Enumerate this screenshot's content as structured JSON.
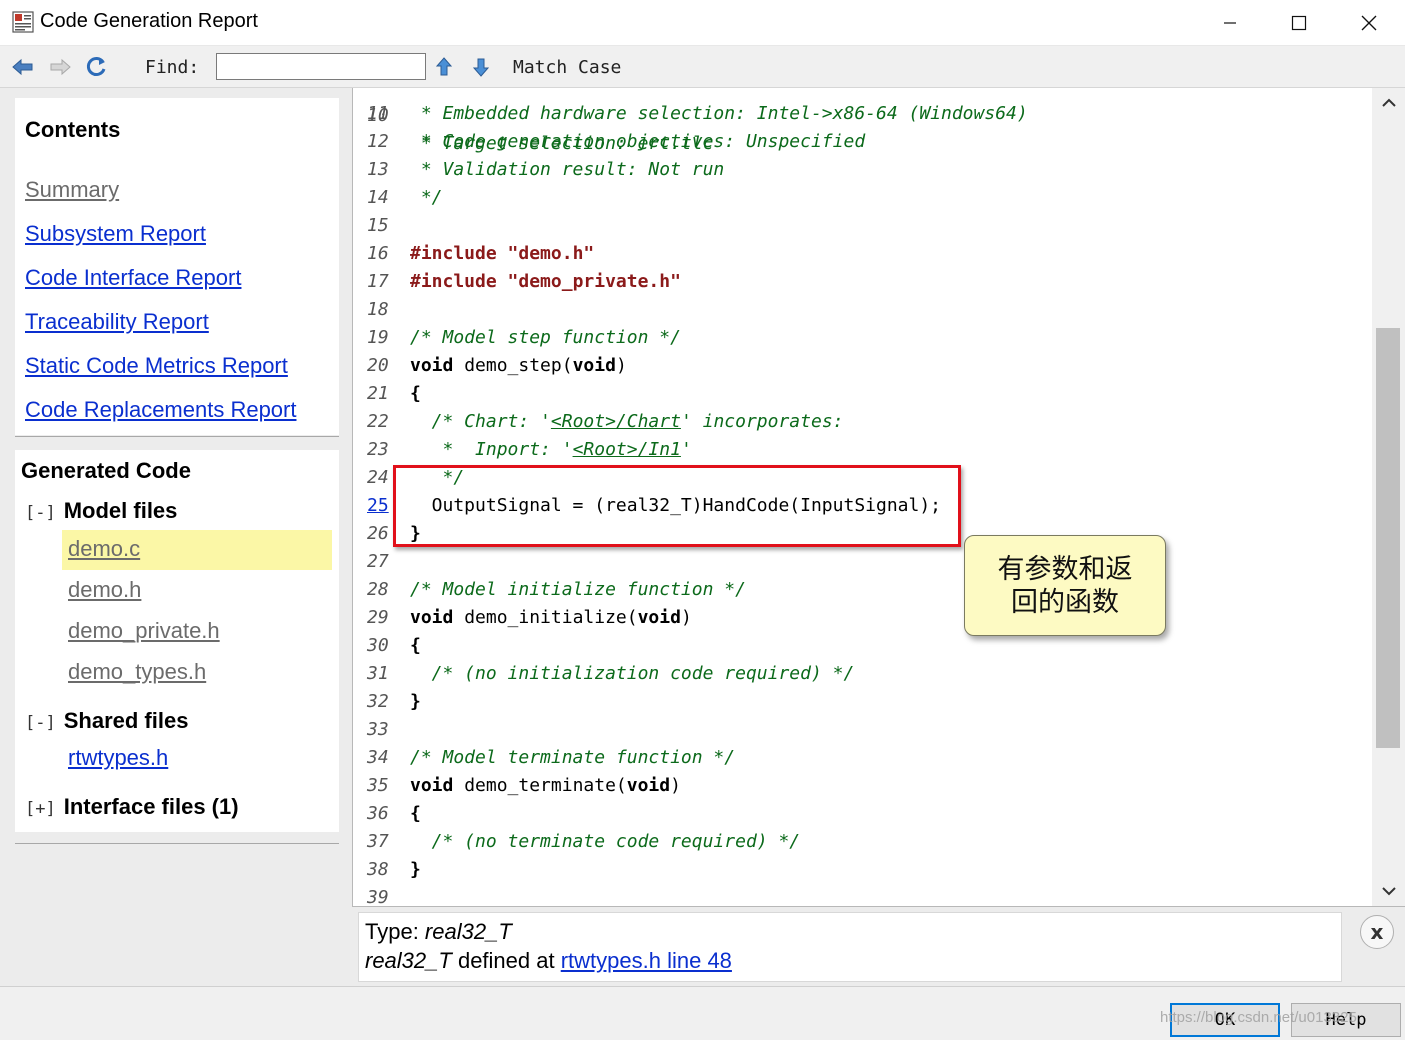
{
  "window": {
    "title": "Code Generation Report"
  },
  "toolbar": {
    "find_label": "Find:",
    "find_value": "",
    "match_case_label": "Match Case"
  },
  "contents": {
    "title": "Contents",
    "links": [
      {
        "label": "Summary",
        "visited": true
      },
      {
        "label": "Subsystem Report",
        "visited": false
      },
      {
        "label": "Code Interface Report",
        "visited": false
      },
      {
        "label": "Traceability Report",
        "visited": false
      },
      {
        "label": "Static Code Metrics Report",
        "visited": false
      },
      {
        "label": "Code Replacements Report",
        "visited": false
      }
    ]
  },
  "generated_code": {
    "title": "Generated Code",
    "model_files": {
      "toggle": "[-]",
      "label": "Model files",
      "files": [
        "demo.c",
        "demo.h",
        "demo_private.h",
        "demo_types.h"
      ],
      "selected": "demo.c"
    },
    "shared_files": {
      "toggle": "[-]",
      "label": "Shared files",
      "files": [
        "rtwtypes.h"
      ]
    },
    "interface_files": {
      "toggle": "[+]",
      "label": "Interface files (1)"
    }
  },
  "code": {
    "top_partial": {
      "num": "10",
      "text": " * Target selection: ert.tlc"
    },
    "lines": [
      {
        "num": "11",
        "text": " * Embedded hardware selection: Intel->x86-64 (Windows64)"
      },
      {
        "num": "12",
        "text": " * Code generation objectives: Unspecified"
      },
      {
        "num": "13",
        "text": " * Validation result: Not run"
      },
      {
        "num": "14",
        "text": " */"
      },
      {
        "num": "15",
        "text": ""
      },
      {
        "num": "16",
        "directive": "#include",
        "string": "\"demo.h\""
      },
      {
        "num": "17",
        "directive": "#include",
        "string": "\"demo_private.h\""
      },
      {
        "num": "18",
        "text": ""
      },
      {
        "num": "19",
        "comment": "/* Model step function */"
      },
      {
        "num": "20",
        "kw1": "void",
        "mid": " demo_step(",
        "kw2": "void",
        "tail": ")"
      },
      {
        "num": "21",
        "brace": "{"
      },
      {
        "num": "22",
        "pre": "  /* Chart: '",
        "link": "<Root>/Chart",
        "post": "' incorporates:"
      },
      {
        "num": "23",
        "pre": "   *  Inport: '",
        "link": "<Root>/In1",
        "post": "'"
      },
      {
        "num": "24",
        "comment": "   */"
      },
      {
        "num": "25",
        "plain": "  OutputSignal = (real32_T)HandCode(InputSignal);",
        "linked": true
      },
      {
        "num": "26",
        "brace": "}"
      },
      {
        "num": "27",
        "text": ""
      },
      {
        "num": "28",
        "comment": "/* Model initialize function */"
      },
      {
        "num": "29",
        "kw1": "void",
        "mid": " demo_initialize(",
        "kw2": "void",
        "tail": ")"
      },
      {
        "num": "30",
        "brace": "{"
      },
      {
        "num": "31",
        "comment": "  /* (no initialization code required) */"
      },
      {
        "num": "32",
        "brace": "}"
      },
      {
        "num": "33",
        "text": ""
      },
      {
        "num": "34",
        "comment": "/* Model terminate function */"
      },
      {
        "num": "35",
        "kw1": "void",
        "mid": " demo_terminate(",
        "kw2": "void",
        "tail": ")"
      },
      {
        "num": "36",
        "brace": "{"
      },
      {
        "num": "37",
        "comment": "  /* (no terminate code required) */"
      },
      {
        "num": "38",
        "brace": "}"
      },
      {
        "num": "39",
        "text": ""
      }
    ]
  },
  "callout": {
    "text": "有参数和返回的函数"
  },
  "info": {
    "type_label": "Type: ",
    "type_value": "real32_T",
    "def_type": "real32_T",
    "def_text": " defined at ",
    "def_link": "rtwtypes.h line 48",
    "close_label": "x"
  },
  "footer": {
    "ok_label": "OK",
    "help_label": "Help",
    "watermark": "https://blog.csdn.net/u013325"
  },
  "colors": {
    "link": "#0a2fcf",
    "comment": "#0c6a1b",
    "string": "#8b1a1a",
    "highlight": "#fbf7a6",
    "annotation_red": "#e1101a",
    "callout_bg": "#fdfac3"
  }
}
